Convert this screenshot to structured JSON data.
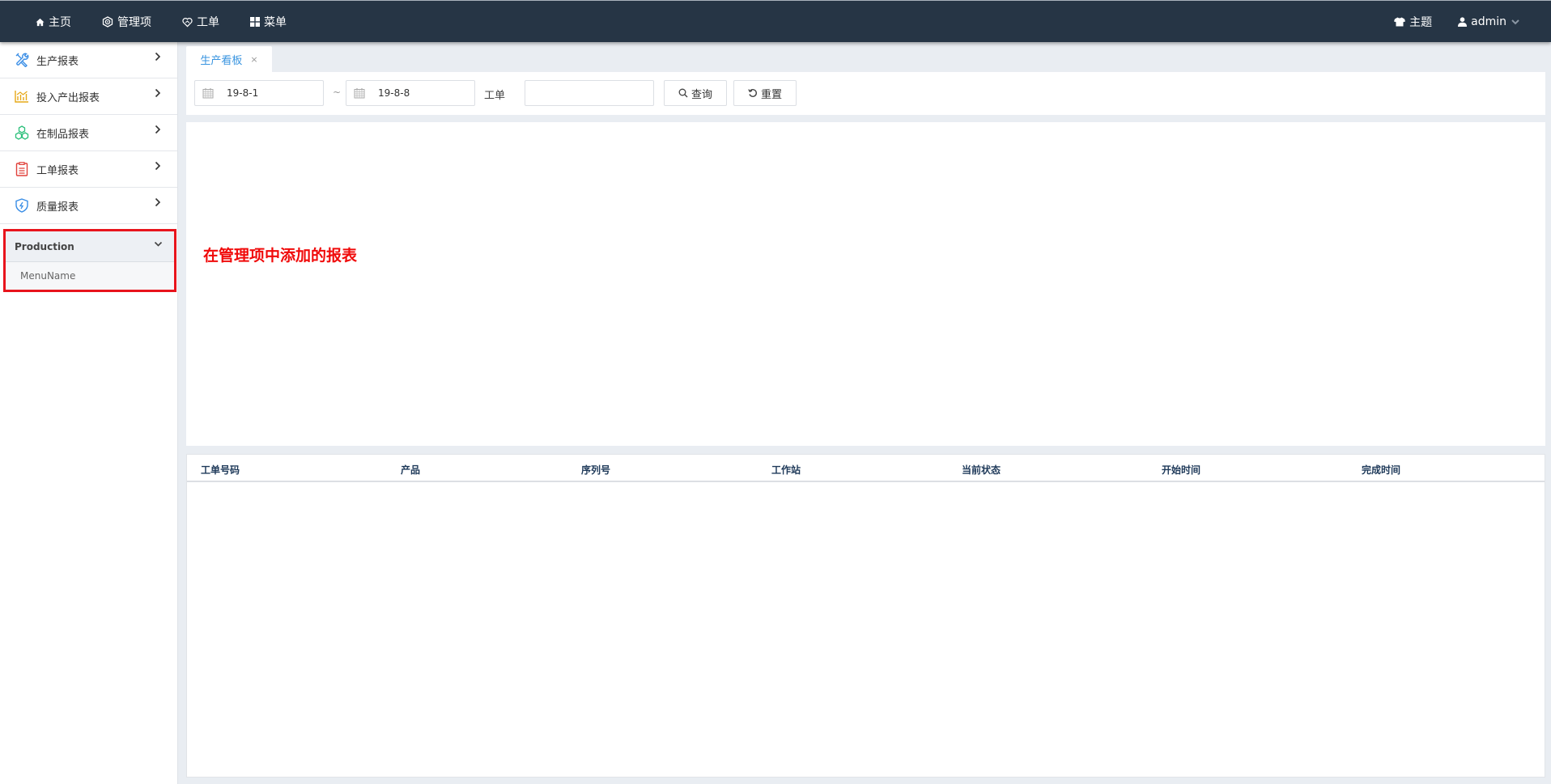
{
  "header": {
    "nav": [
      {
        "label": "主页",
        "icon": "home-icon"
      },
      {
        "label": "管理项",
        "icon": "settings-hex-icon"
      },
      {
        "label": "工单",
        "icon": "heart-handshake-icon"
      },
      {
        "label": "菜单",
        "icon": "grid-icon"
      }
    ],
    "theme_label": "主题",
    "user_label": "admin"
  },
  "sidebar": {
    "items": [
      {
        "label": "生产报表",
        "icon": "tools-icon",
        "color": "#3a8ee6"
      },
      {
        "label": "投入产出报表",
        "icon": "bar-chart-icon",
        "color": "#e6a817"
      },
      {
        "label": "在制品报表",
        "icon": "cubes-icon",
        "color": "#2bbf7a"
      },
      {
        "label": "工单报表",
        "icon": "clipboard-icon",
        "color": "#e0413b"
      },
      {
        "label": "质量报表",
        "icon": "shield-icon",
        "color": "#3a8ee6"
      }
    ],
    "group": {
      "label": "Production",
      "sub_items": [
        {
          "label": "MenuName"
        }
      ]
    }
  },
  "tabs": [
    {
      "label": "生产看板",
      "close": "×"
    }
  ],
  "toolbar": {
    "start_date": "19-8-1",
    "separator": "~",
    "end_date": "19-8-8",
    "workorder_label": "工单",
    "workorder_value": "",
    "query_label": "查询",
    "reset_label": "重置"
  },
  "annotation": "在管理项中添加的报表",
  "table": {
    "columns": [
      "工单号码",
      "产品",
      "序列号",
      "工作站",
      "当前状态",
      "开始时间",
      "完成时间"
    ],
    "rows": []
  },
  "colors": {
    "header_bg": "#263545",
    "accent": "#3a95e0",
    "annotation": "#f00a0a",
    "highlight_box": "#e8141c"
  }
}
